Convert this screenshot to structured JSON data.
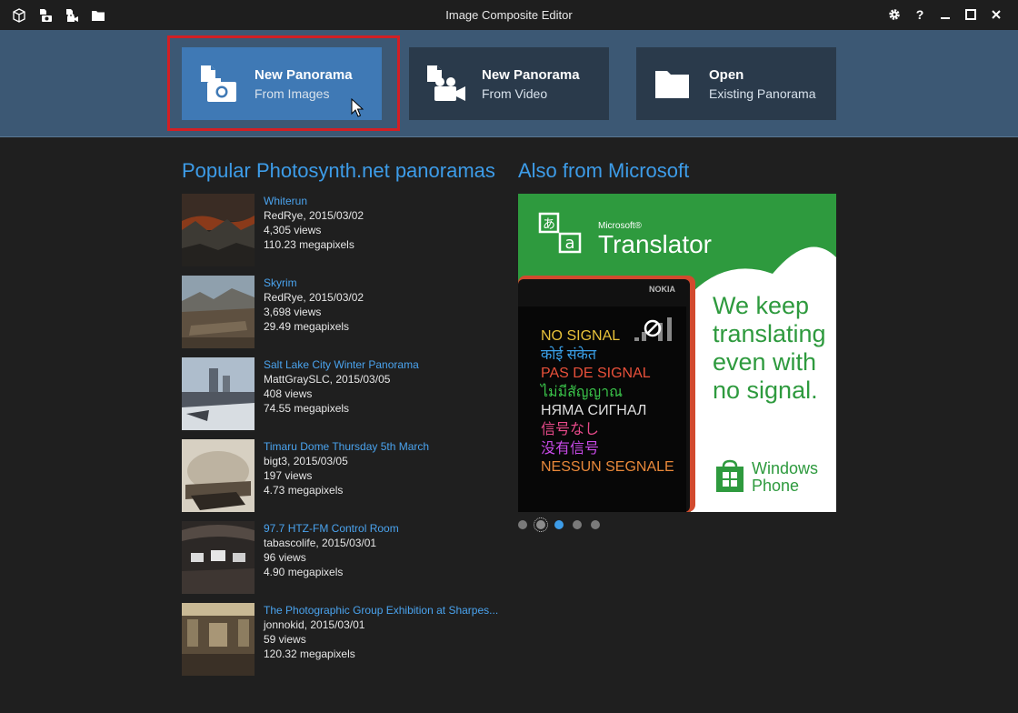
{
  "window": {
    "title": "Image Composite Editor",
    "toolbar_icons": [
      "cube-icon",
      "new-from-images-icon",
      "new-from-video-icon",
      "open-folder-icon"
    ],
    "controls": [
      "settings-icon",
      "help-icon",
      "minimize-icon",
      "maximize-icon",
      "close-icon"
    ],
    "help_label": "?"
  },
  "header": {
    "tiles": [
      {
        "title": "New Panorama",
        "subtitle": "From Images",
        "icon": "camera-document-icon"
      },
      {
        "title": "New Panorama",
        "subtitle": "From Video",
        "icon": "video-camera-document-icon"
      },
      {
        "title": "Open",
        "subtitle": "Existing Panorama",
        "icon": "folder-icon"
      }
    ]
  },
  "popular": {
    "heading": "Popular Photosynth.net panoramas",
    "items": [
      {
        "name": "Whiterun",
        "author_date": "RedRye, 2015/03/02",
        "views": "4,305 views",
        "size": "110.23 megapixels"
      },
      {
        "name": "Skyrim",
        "author_date": "RedRye, 2015/03/02",
        "views": "3,698 views",
        "size": "29.49 megapixels"
      },
      {
        "name": "Salt Lake City Winter Panorama",
        "author_date": "MattGraySLC, 2015/03/05",
        "views": "408 views",
        "size": "74.55 megapixels"
      },
      {
        "name": "Timaru Dome Thursday 5th March",
        "author_date": "bigt3, 2015/03/05",
        "views": "197 views",
        "size": "4.73 megapixels"
      },
      {
        "name": "97.7 HTZ-FM Control Room",
        "author_date": "tabascolife, 2015/03/01",
        "views": "96 views",
        "size": "4.90 megapixels"
      },
      {
        "name": "The Photographic Group Exhibition at Sharpes...",
        "author_date": "jonnokid, 2015/03/01",
        "views": "59 views",
        "size": "120.32 megapixels"
      }
    ]
  },
  "microsoft": {
    "heading": "Also from Microsoft",
    "ad": {
      "brand": "Microsoft®",
      "product": "Translator",
      "phone_brand": "NOKIA",
      "tagline": [
        "We keep",
        "translating",
        "even with",
        "no signal."
      ],
      "platform": [
        "Windows",
        "Phone"
      ],
      "phone_lines": [
        {
          "text": "NO SIGNAL",
          "color": "#e8c23a"
        },
        {
          "text": "कोई संकेत",
          "color": "#3aa0e8"
        },
        {
          "text": "PAS DE SIGNAL",
          "color": "#e8503a"
        },
        {
          "text": "ไม่มีสัญญาณ",
          "color": "#3ac44a"
        },
        {
          "text": "НЯМА СИГНАЛ",
          "color": "#dedede"
        },
        {
          "text": "信号なし",
          "color": "#e84a8a"
        },
        {
          "text": "没有信号",
          "color": "#c84ae8"
        },
        {
          "text": "NESSUN SEGNALE",
          "color": "#e8883a"
        }
      ]
    },
    "carousel": {
      "count": 5,
      "active": 2,
      "focused": 1
    }
  },
  "colors": {
    "accent": "#3d9ce8",
    "header": "#3c5874",
    "primary_tile": "#3f79b5",
    "highlight": "#d21f24",
    "ad_green": "#2e9a3e"
  }
}
